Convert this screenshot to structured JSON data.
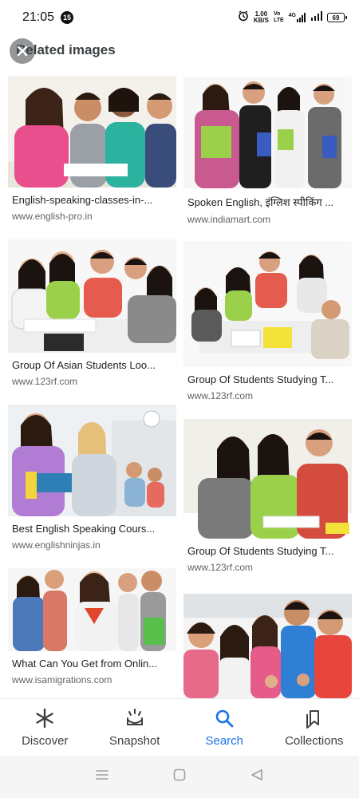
{
  "status": {
    "time": "21:05",
    "badge": "15",
    "speed_value": "1.00",
    "speed_unit": "KB/S",
    "volte_top": "Vo",
    "volte_bottom": "LTE",
    "network": "4G",
    "battery": "69"
  },
  "header": {
    "title": "Related images"
  },
  "results": {
    "left": [
      {
        "caption": "English-speaking-classes-in-...",
        "source": "www.english-pro.in"
      },
      {
        "caption": "Group Of Asian Students Loo...",
        "source": "www.123rf.com"
      },
      {
        "caption": "Best English Speaking Cours...",
        "source": "www.englishninjas.in"
      },
      {
        "caption": "What Can You Get from Onlin...",
        "source": "www.isamigrations.com"
      }
    ],
    "right": [
      {
        "caption": "Spoken English, इंग्लिश स्पीकिंग ...",
        "source": "www.indiamart.com"
      },
      {
        "caption": "Group Of Students Studying T...",
        "source": "www.123rf.com"
      },
      {
        "caption": "Group Of Students Studying T...",
        "source": "www.123rf.com"
      }
    ]
  },
  "nav": {
    "discover": "Discover",
    "snapshot": "Snapshot",
    "search": "Search",
    "collections": "Collections"
  },
  "colors": {
    "accent": "#1a73e8",
    "text_secondary": "#5f6368"
  }
}
